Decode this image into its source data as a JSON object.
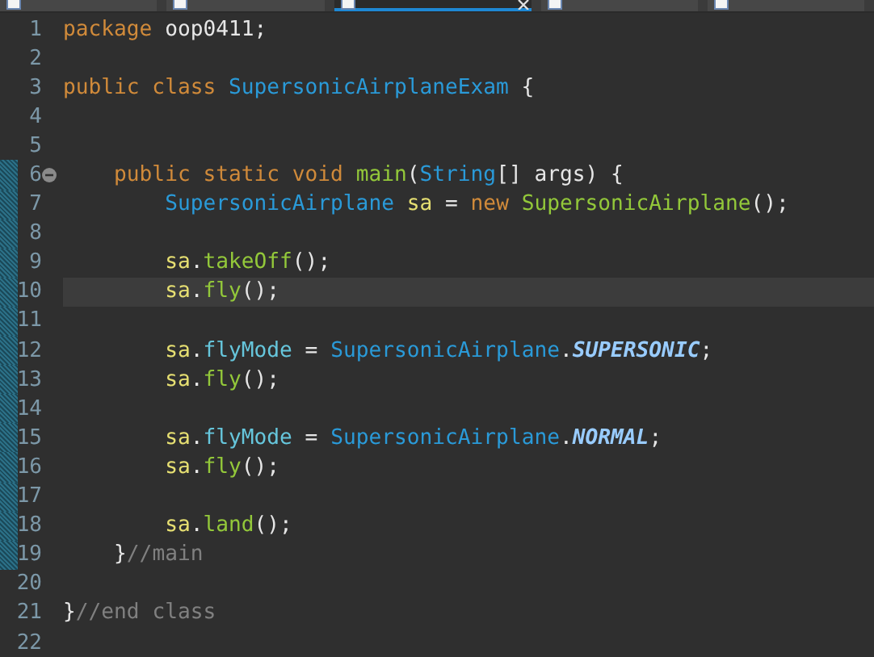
{
  "tabs": [
    {
      "selected": false
    },
    {
      "selected": false
    },
    {
      "selected": true
    },
    {
      "selected": false
    },
    {
      "selected": false
    }
  ],
  "lines": [
    {
      "number": "1",
      "tokens": [
        {
          "kind": "kw",
          "text": "package "
        },
        {
          "kind": "plain",
          "text": "oop0411;"
        }
      ]
    },
    {
      "number": "2"
    },
    {
      "number": "3",
      "tokens": [
        {
          "kind": "kw",
          "text": "public class "
        },
        {
          "kind": "type",
          "text": "SupersonicAirplaneExam"
        },
        {
          "kind": "plain",
          "text": " {"
        }
      ]
    },
    {
      "number": "4"
    },
    {
      "number": "5"
    },
    {
      "number": "6",
      "changed": true,
      "fold": true,
      "tokens": [
        {
          "kind": "kw",
          "text": "    public static void "
        },
        {
          "kind": "method",
          "text": "main"
        },
        {
          "kind": "plain",
          "text": "("
        },
        {
          "kind": "type",
          "text": "String"
        },
        {
          "kind": "plain",
          "text": "[] args) {"
        }
      ]
    },
    {
      "number": "7",
      "changed": true,
      "tokens": [
        {
          "kind": "type",
          "text": "        SupersonicAirplane "
        },
        {
          "kind": "var",
          "text": "sa"
        },
        {
          "kind": "plain",
          "text": " = "
        },
        {
          "kind": "kw",
          "text": "new "
        },
        {
          "kind": "method",
          "text": "SupersonicAirplane"
        },
        {
          "kind": "plain",
          "text": "();"
        }
      ]
    },
    {
      "number": "8",
      "changed": true
    },
    {
      "number": "9",
      "changed": true,
      "tokens": [
        {
          "kind": "var",
          "text": "        sa"
        },
        {
          "kind": "plain",
          "text": "."
        },
        {
          "kind": "method",
          "text": "takeOff"
        },
        {
          "kind": "plain",
          "text": "();"
        }
      ]
    },
    {
      "number": "10",
      "current": true,
      "changed": true,
      "tokens": [
        {
          "kind": "var",
          "text": "        sa"
        },
        {
          "kind": "plain",
          "text": "."
        },
        {
          "kind": "method",
          "text": "fly"
        },
        {
          "kind": "plain",
          "text": "();"
        }
      ]
    },
    {
      "number": "11",
      "changed": true
    },
    {
      "number": "12",
      "changed": true,
      "tokens": [
        {
          "kind": "var",
          "text": "        sa"
        },
        {
          "kind": "plain",
          "text": "."
        },
        {
          "kind": "field",
          "text": "flyMode"
        },
        {
          "kind": "plain",
          "text": " = "
        },
        {
          "kind": "type",
          "text": "SupersonicAirplane"
        },
        {
          "kind": "plain",
          "text": "."
        },
        {
          "kind": "const",
          "text": "SUPERSONIC"
        },
        {
          "kind": "plain",
          "text": ";"
        }
      ]
    },
    {
      "number": "13",
      "changed": true,
      "tokens": [
        {
          "kind": "var",
          "text": "        sa"
        },
        {
          "kind": "plain",
          "text": "."
        },
        {
          "kind": "method",
          "text": "fly"
        },
        {
          "kind": "plain",
          "text": "();"
        }
      ]
    },
    {
      "number": "14",
      "changed": true
    },
    {
      "number": "15",
      "changed": true,
      "tokens": [
        {
          "kind": "var",
          "text": "        sa"
        },
        {
          "kind": "plain",
          "text": "."
        },
        {
          "kind": "field",
          "text": "flyMode"
        },
        {
          "kind": "plain",
          "text": " = "
        },
        {
          "kind": "type",
          "text": "SupersonicAirplane"
        },
        {
          "kind": "plain",
          "text": "."
        },
        {
          "kind": "const",
          "text": "NORMAL"
        },
        {
          "kind": "plain",
          "text": ";"
        }
      ]
    },
    {
      "number": "16",
      "changed": true,
      "tokens": [
        {
          "kind": "var",
          "text": "        sa"
        },
        {
          "kind": "plain",
          "text": "."
        },
        {
          "kind": "method",
          "text": "fly"
        },
        {
          "kind": "plain",
          "text": "();"
        }
      ]
    },
    {
      "number": "17",
      "changed": true
    },
    {
      "number": "18",
      "changed": true,
      "tokens": [
        {
          "kind": "var",
          "text": "        sa"
        },
        {
          "kind": "plain",
          "text": "."
        },
        {
          "kind": "method",
          "text": "land"
        },
        {
          "kind": "plain",
          "text": "();"
        }
      ]
    },
    {
      "number": "19",
      "changed": true,
      "tokens": [
        {
          "kind": "plain",
          "text": "    }"
        },
        {
          "kind": "comment",
          "text": "//main"
        }
      ]
    },
    {
      "number": "20"
    },
    {
      "number": "21",
      "tokens": [
        {
          "kind": "plain",
          "text": "}"
        },
        {
          "kind": "comment",
          "text": "//end class"
        }
      ]
    },
    {
      "number": "22"
    }
  ]
}
